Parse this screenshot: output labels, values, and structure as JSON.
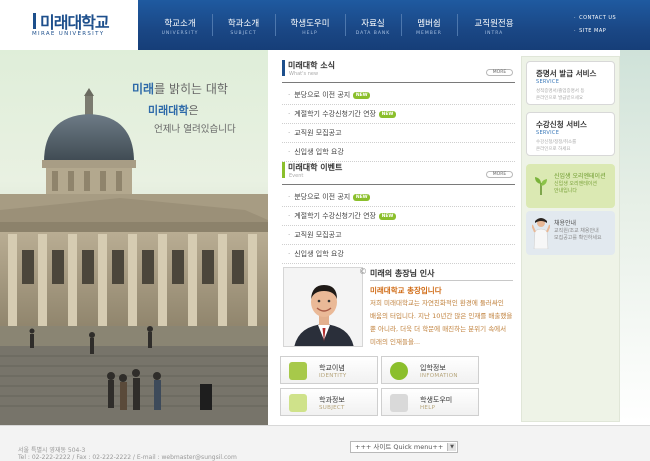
{
  "logo": {
    "title": "미래대학교",
    "subtitle": "MIRAE UNIVERSITY"
  },
  "nav": [
    {
      "ko": "학교소개",
      "en": "UNIVERSITY"
    },
    {
      "ko": "학과소개",
      "en": "SUBJECT"
    },
    {
      "ko": "학생도우미",
      "en": "HELP"
    },
    {
      "ko": "자료실",
      "en": "DATA BANK"
    },
    {
      "ko": "멤버쉽",
      "en": "MEMBER"
    },
    {
      "ko": "교직원전용",
      "en": "INTRA"
    }
  ],
  "util": {
    "contact": "CONTACT US",
    "sitemap": "SITE MAP"
  },
  "hero": {
    "line1_hl": "미래",
    "line1_rest": "를 밝히는 대학",
    "line2_hl": "미래대학",
    "line2_rest": "은",
    "line3": "언제나 열려있습니다"
  },
  "news": {
    "title": "미래대학 소식",
    "subtitle": "What's new",
    "more": "MORE",
    "items": [
      {
        "text": "분당으로 이전 공지",
        "new": "NEW"
      },
      {
        "text": "계절학기 수강신청기간 연장",
        "new": "NEW"
      },
      {
        "text": "교직원 모집공고",
        "new": ""
      },
      {
        "text": "신입생 입학 요강",
        "new": ""
      }
    ]
  },
  "events": {
    "title": "미래대학 이벤트",
    "subtitle": "Event",
    "more": "MORE",
    "items": [
      {
        "text": "분당으로 이전 공지",
        "new": "NEW"
      },
      {
        "text": "계절학기 수강신청기간 연장",
        "new": "NEW"
      },
      {
        "text": "교직원 모집공고",
        "new": ""
      },
      {
        "text": "신입생 입학 요강",
        "new": ""
      }
    ]
  },
  "greeting": {
    "title": "미래의 총장님 인사",
    "heading": "미래대학교 총장입니다",
    "text": "저희 미래대학교는 자연친화적인 환경에 둘러싸인 배움의 터입니다. 지난 10년간 많은 인재를 배출했을 뿐 아니라, 더욱 더 학문에 매진하는 분위기 속에서 미래의 인재들을..."
  },
  "quick": [
    {
      "ko": "학교이념",
      "en": "IDENTITY"
    },
    {
      "ko": "입학정보",
      "en": "INFOMATION"
    },
    {
      "ko": "학과정보",
      "en": "SUBJECT"
    },
    {
      "ko": "학생도우미",
      "en": "HELP"
    }
  ],
  "side": {
    "cert": {
      "title": "증명서 발급 서비스",
      "en": "SERVICE",
      "desc1": "성적증명서/졸업증명서 등",
      "desc2": "온라인으로 발급받으세요"
    },
    "course": {
      "title": "수강신청 서비스",
      "en": "SERVICE",
      "desc1": "수강신청/정정/취소를",
      "desc2": "온라인으로 하세요"
    },
    "orient": {
      "title": "신입생 오리엔테이션",
      "desc1": "신입생 오리엔테이션",
      "desc2": "안내입니다"
    },
    "recruit": {
      "title": "채용안내",
      "desc1": "교직원/조교 채용안내",
      "desc2": "모집공고를 확인하세요"
    }
  },
  "footer": {
    "address": "서울 특별시 영재동 504-3",
    "contact": "Tel : 02-222-2222  /  Fax : 02-222-2222  /  E-mail : webmaster@sungsil.com",
    "quickmenu": "+++ 사이트 Quick menu++"
  },
  "colors": {
    "brand": "#1d4f8c",
    "accent_green": "#8bbf2c",
    "accent_orange": "#d06b15"
  }
}
